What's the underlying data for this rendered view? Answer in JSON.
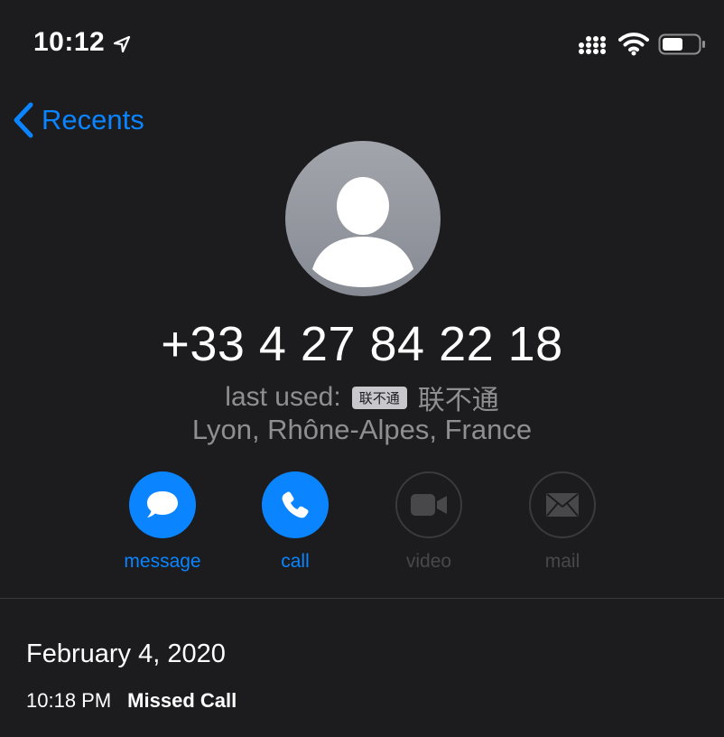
{
  "status_bar": {
    "time": "10:12",
    "icons": [
      "location-arrow-icon",
      "cellular-signal-icon",
      "wifi-icon",
      "battery-icon"
    ]
  },
  "nav": {
    "back_label": "Recents"
  },
  "contact": {
    "phone_number": "+33 4 27 84 22 18",
    "last_used_label": "last used:",
    "sim_badge": "联不通",
    "sim_name": "联不通",
    "location": "Lyon, Rhône-Alpes, France"
  },
  "actions": [
    {
      "label": "message",
      "icon": "message-bubble-icon",
      "enabled": true
    },
    {
      "label": "call",
      "icon": "phone-icon",
      "enabled": true
    },
    {
      "label": "video",
      "icon": "video-camera-icon",
      "enabled": false
    },
    {
      "label": "mail",
      "icon": "envelope-icon",
      "enabled": false
    }
  ],
  "history": {
    "date": "February 4, 2020",
    "entries": [
      {
        "time": "10:18 PM",
        "status": "Missed Call"
      }
    ]
  },
  "colors": {
    "background": "#1c1c1e",
    "accent": "#0a84ff",
    "secondary_text": "#8e8e93",
    "disabled": "#48484a"
  }
}
